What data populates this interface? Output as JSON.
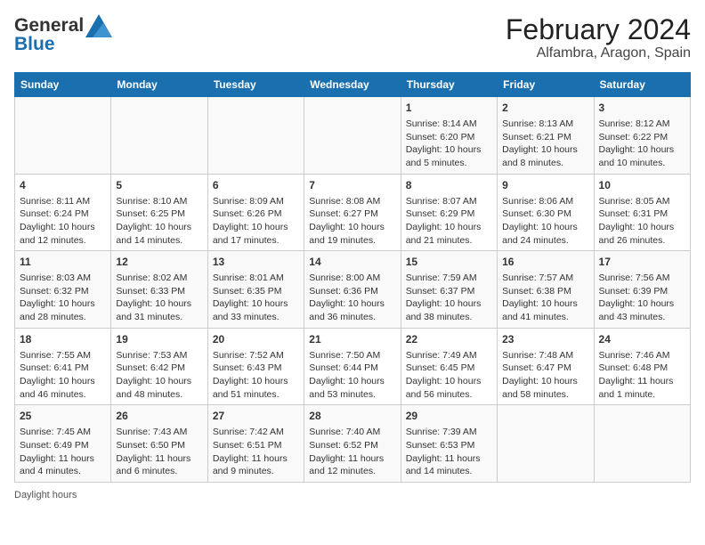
{
  "header": {
    "logo_text_general": "General",
    "logo_text_blue": "Blue",
    "title": "February 2024",
    "subtitle": "Alfambra, Aragon, Spain"
  },
  "calendar": {
    "days_of_week": [
      "Sunday",
      "Monday",
      "Tuesday",
      "Wednesday",
      "Thursday",
      "Friday",
      "Saturday"
    ],
    "weeks": [
      [
        {
          "day": "",
          "info": ""
        },
        {
          "day": "",
          "info": ""
        },
        {
          "day": "",
          "info": ""
        },
        {
          "day": "",
          "info": ""
        },
        {
          "day": "1",
          "info": "Sunrise: 8:14 AM\nSunset: 6:20 PM\nDaylight: 10 hours and 5 minutes."
        },
        {
          "day": "2",
          "info": "Sunrise: 8:13 AM\nSunset: 6:21 PM\nDaylight: 10 hours and 8 minutes."
        },
        {
          "day": "3",
          "info": "Sunrise: 8:12 AM\nSunset: 6:22 PM\nDaylight: 10 hours and 10 minutes."
        }
      ],
      [
        {
          "day": "4",
          "info": "Sunrise: 8:11 AM\nSunset: 6:24 PM\nDaylight: 10 hours and 12 minutes."
        },
        {
          "day": "5",
          "info": "Sunrise: 8:10 AM\nSunset: 6:25 PM\nDaylight: 10 hours and 14 minutes."
        },
        {
          "day": "6",
          "info": "Sunrise: 8:09 AM\nSunset: 6:26 PM\nDaylight: 10 hours and 17 minutes."
        },
        {
          "day": "7",
          "info": "Sunrise: 8:08 AM\nSunset: 6:27 PM\nDaylight: 10 hours and 19 minutes."
        },
        {
          "day": "8",
          "info": "Sunrise: 8:07 AM\nSunset: 6:29 PM\nDaylight: 10 hours and 21 minutes."
        },
        {
          "day": "9",
          "info": "Sunrise: 8:06 AM\nSunset: 6:30 PM\nDaylight: 10 hours and 24 minutes."
        },
        {
          "day": "10",
          "info": "Sunrise: 8:05 AM\nSunset: 6:31 PM\nDaylight: 10 hours and 26 minutes."
        }
      ],
      [
        {
          "day": "11",
          "info": "Sunrise: 8:03 AM\nSunset: 6:32 PM\nDaylight: 10 hours and 28 minutes."
        },
        {
          "day": "12",
          "info": "Sunrise: 8:02 AM\nSunset: 6:33 PM\nDaylight: 10 hours and 31 minutes."
        },
        {
          "day": "13",
          "info": "Sunrise: 8:01 AM\nSunset: 6:35 PM\nDaylight: 10 hours and 33 minutes."
        },
        {
          "day": "14",
          "info": "Sunrise: 8:00 AM\nSunset: 6:36 PM\nDaylight: 10 hours and 36 minutes."
        },
        {
          "day": "15",
          "info": "Sunrise: 7:59 AM\nSunset: 6:37 PM\nDaylight: 10 hours and 38 minutes."
        },
        {
          "day": "16",
          "info": "Sunrise: 7:57 AM\nSunset: 6:38 PM\nDaylight: 10 hours and 41 minutes."
        },
        {
          "day": "17",
          "info": "Sunrise: 7:56 AM\nSunset: 6:39 PM\nDaylight: 10 hours and 43 minutes."
        }
      ],
      [
        {
          "day": "18",
          "info": "Sunrise: 7:55 AM\nSunset: 6:41 PM\nDaylight: 10 hours and 46 minutes."
        },
        {
          "day": "19",
          "info": "Sunrise: 7:53 AM\nSunset: 6:42 PM\nDaylight: 10 hours and 48 minutes."
        },
        {
          "day": "20",
          "info": "Sunrise: 7:52 AM\nSunset: 6:43 PM\nDaylight: 10 hours and 51 minutes."
        },
        {
          "day": "21",
          "info": "Sunrise: 7:50 AM\nSunset: 6:44 PM\nDaylight: 10 hours and 53 minutes."
        },
        {
          "day": "22",
          "info": "Sunrise: 7:49 AM\nSunset: 6:45 PM\nDaylight: 10 hours and 56 minutes."
        },
        {
          "day": "23",
          "info": "Sunrise: 7:48 AM\nSunset: 6:47 PM\nDaylight: 10 hours and 58 minutes."
        },
        {
          "day": "24",
          "info": "Sunrise: 7:46 AM\nSunset: 6:48 PM\nDaylight: 11 hours and 1 minute."
        }
      ],
      [
        {
          "day": "25",
          "info": "Sunrise: 7:45 AM\nSunset: 6:49 PM\nDaylight: 11 hours and 4 minutes."
        },
        {
          "day": "26",
          "info": "Sunrise: 7:43 AM\nSunset: 6:50 PM\nDaylight: 11 hours and 6 minutes."
        },
        {
          "day": "27",
          "info": "Sunrise: 7:42 AM\nSunset: 6:51 PM\nDaylight: 11 hours and 9 minutes."
        },
        {
          "day": "28",
          "info": "Sunrise: 7:40 AM\nSunset: 6:52 PM\nDaylight: 11 hours and 12 minutes."
        },
        {
          "day": "29",
          "info": "Sunrise: 7:39 AM\nSunset: 6:53 PM\nDaylight: 11 hours and 14 minutes."
        },
        {
          "day": "",
          "info": ""
        },
        {
          "day": "",
          "info": ""
        }
      ]
    ]
  },
  "footer": {
    "daylight_hours_label": "Daylight hours"
  }
}
